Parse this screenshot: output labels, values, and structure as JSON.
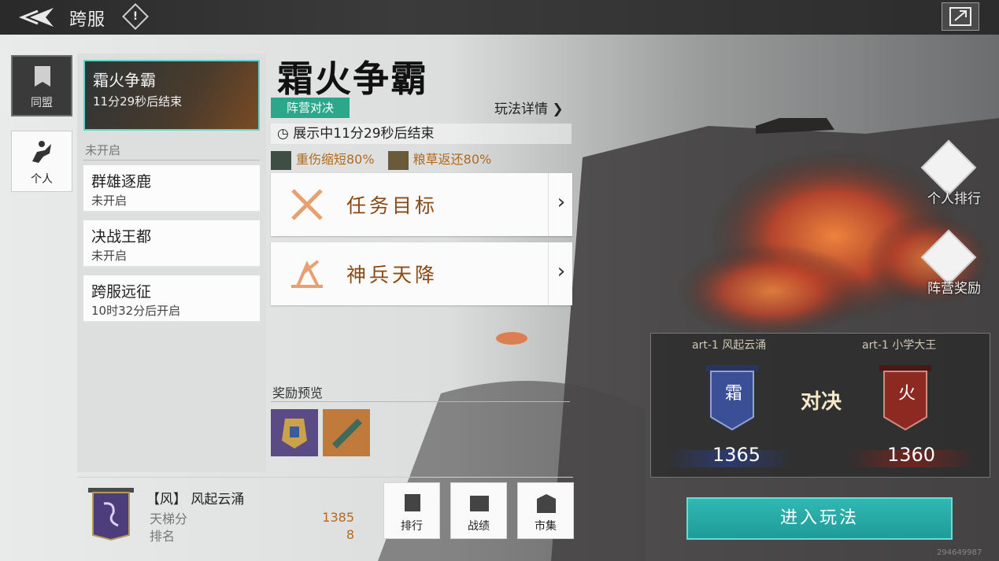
{
  "header": {
    "title": "跨服",
    "info_icon": "exclamation-icon",
    "back_icon": "back-arrow-icon",
    "right_icon": "exit-icon"
  },
  "left_tabs": [
    {
      "label": "同盟",
      "icon": "banner-icon"
    },
    {
      "label": "个人",
      "icon": "horseman-icon"
    }
  ],
  "modes": {
    "active": {
      "name": "霜火争霸",
      "status": "11分29秒后结束"
    },
    "section_label": "未开启",
    "items": [
      {
        "name": "群雄逐鹿",
        "status": "未开启"
      },
      {
        "name": "决战王都",
        "status": "未开启"
      },
      {
        "name": "跨服远征",
        "status": "10时32分后开启"
      }
    ]
  },
  "detail": {
    "title": "霜火争霸",
    "tag": "阵营对决",
    "rules_link": "玩法详情",
    "time_text": "展示中11分29秒后结束",
    "buffs": [
      {
        "text": "重伤缩短80%",
        "icon": "healing-icon"
      },
      {
        "text": "粮草返还80%",
        "icon": "grain-icon"
      }
    ],
    "actions": [
      {
        "label": "任务目标",
        "icon": "crossed-swords-icon"
      },
      {
        "label": "神兵天降",
        "icon": "catapult-icon"
      }
    ],
    "rewards_label": "奖励预览",
    "rewards": [
      {
        "icon": "armor-reward-icon",
        "color": "#5a4a86"
      },
      {
        "icon": "scroll-reward-icon",
        "color": "#c07a3c"
      }
    ]
  },
  "side_buttons": [
    {
      "label": "个人排行",
      "icon": "ranking-icon"
    },
    {
      "label": "阵营奖励",
      "icon": "chest-icon"
    }
  ],
  "versus": {
    "left": {
      "name": "art-1 风起云涌",
      "flag": "霜",
      "score": "1365",
      "color": "#3b4f96"
    },
    "right": {
      "name": "art-1 小学大王",
      "flag": "火",
      "score": "1360",
      "color": "#8c2a22"
    },
    "vs_text": "对决"
  },
  "enter_button": "进入玩法",
  "player": {
    "name": "【风】 风起云涌",
    "ladder_label": "天梯分",
    "ladder_value": "1385",
    "rank_label": "排名",
    "rank_value": "8"
  },
  "bottom_buttons": [
    {
      "label": "排行",
      "icon": "ranking-icon"
    },
    {
      "label": "战绩",
      "icon": "record-icon"
    },
    {
      "label": "市集",
      "icon": "market-icon"
    }
  ],
  "build_id": "294649987"
}
